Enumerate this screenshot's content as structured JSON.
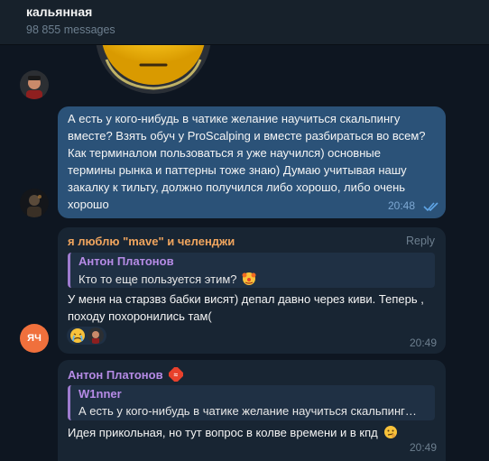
{
  "header": {
    "title": "кальянная",
    "subtitle": "98 855 messages"
  },
  "messages": [
    {
      "text_lines": [
        "А есть у кого-нибудь в чатике желание научиться скальпингу",
        "вместе? Взять обуч у ProScalping и вместе разбираться во всем?",
        "Как терминалом пользоваться я уже научился) основные",
        "термины рынка и паттерны тоже знаю) Думаю учитывая нашу",
        "закалку к тильту, должно получился либо хорошо, либо очень",
        "хорошо"
      ],
      "time": "20:48"
    },
    {
      "sender": "я люблю \"mave\" и челенджи",
      "reply_label": "Reply",
      "quote_name": "Антон Платонов",
      "quote_text": "Кто то еще пользуется этим?",
      "text_lines": [
        "У меня на старзвз бабки висят) депал давно через киви. Теперь ,",
        "походу похоронились там("
      ],
      "time": "20:49",
      "avatar_initials": "ЯЧ"
    },
    {
      "sender": "Антон Платонов",
      "quote_name": "W1nner",
      "quote_text": "А есть у кого-нибудь в чатике желание научиться скальпинг…",
      "text": "Идея прикольная, но тут вопрос в колве времени и в кпд",
      "time": "20:49"
    }
  ],
  "colors": {
    "background": "#0e1621",
    "header": "#17212b",
    "outgoing_bubble": "#2b5278",
    "incoming_bubble": "#182533",
    "sender_orange": "#f0a55e",
    "sender_purple": "#b68be6",
    "time_incoming": "#6d7f8f",
    "time_outgoing": "#7da8d3",
    "read_check": "#5fa5e6"
  }
}
